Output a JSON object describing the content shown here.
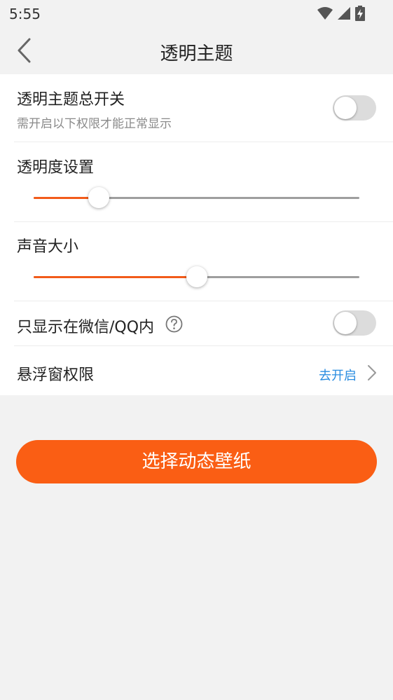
{
  "status_bar": {
    "time": "5:55",
    "icons": [
      "wifi-icon",
      "cellular-signal-icon",
      "battery-charging-icon"
    ]
  },
  "header": {
    "title": "透明主题",
    "back_icon": "chevron-left-icon"
  },
  "settings": {
    "master_switch": {
      "title": "透明主题总开关",
      "subtitle": "需开启以下权限才能正常显示",
      "enabled": false
    },
    "transparency": {
      "title": "透明度设置",
      "value_fraction": 0.2
    },
    "volume": {
      "title": "声音大小",
      "value_fraction": 0.5
    },
    "wechat_qq_only": {
      "title": "只显示在微信/QQ内",
      "help_icon": "question-circle-icon",
      "enabled": false
    },
    "overlay_permission": {
      "title": "悬浮窗权限",
      "action_label": "去开启",
      "action_icon": "chevron-right-icon"
    }
  },
  "primary_action": {
    "label": "选择动态壁纸"
  },
  "colors": {
    "accent": "#fa5e14",
    "link": "#2a8de0",
    "background": "#f2f2f2",
    "card": "#ffffff",
    "slider_inactive": "#9e9e9e",
    "toggle_off": "#dcdcdc"
  }
}
